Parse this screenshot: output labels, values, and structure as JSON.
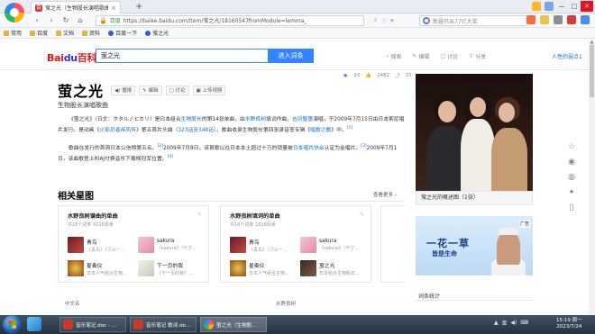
{
  "browser": {
    "tab_title": "萤之光（生物股长演唱歌曲）_百...",
    "tab_favicon": "百",
    "new_tab": "+",
    "safe_label": "百度",
    "url": "https://baike.baidu.com/item/萤之光/18160547fromModule=lemma_",
    "url_host": "https://baike.baidu.com",
    "side_search_placeholder": "新疆开出77亿大奖",
    "window_controls": [
      "—",
      "□",
      "✕"
    ]
  },
  "bookmarks": [
    "常用",
    "百度",
    "文档",
    "资料",
    "百度一下",
    "萤之光"
  ],
  "header": {
    "logo_bai": "Bai",
    "logo_du": "du",
    "logo_baike": "百科",
    "search_value": "萤之光",
    "search_button": "进入词条",
    "links": [
      "搜索",
      "编辑",
      "讨论",
      "分享"
    ],
    "user_link": "人性的弱点1"
  },
  "lemma": {
    "title": "萤之光",
    "actions": [
      "播报",
      "编辑",
      "讨论",
      "上传视频"
    ],
    "subtitle": "生物股长演唱歌曲",
    "stats": {
      "likes": "93",
      "views": "2482",
      "shares": "15"
    },
    "summary_p1_a": "《萤之光》（日文：ホタルノヒカリ）是日本组合",
    "summary_p1_link1": "生物股长",
    "summary_p1_b": "的第14张单曲，由",
    "summary_p1_link2": "水野良树",
    "summary_p1_c": "填词作曲，",
    "summary_p1_link3": "吉冈聖惠",
    "summary_p1_d": "演唱，于2009年7月15日由日本索尼唱片发行。是动画《",
    "summary_p1_link4": "火影忍者疾风传",
    "summary_p1_e": "》第五首片头曲（",
    "summary_p1_link5": "323话至348话",
    "summary_p1_f": "），歌曲收录生物股长第四张录音室专辑《",
    "summary_p1_link6": "唱歌之歌",
    "summary_p1_g": "》中。",
    "sup1": "[1]",
    "summary_p2_a": "歌曲在发行的首周日本公信榜第五名。",
    "sup2": "[2]",
    "summary_p2_b": "2009年7月8日，该首歌以在日本本土超过十万的销量被",
    "summary_p2_link": "日本唱片协会",
    "summary_p2_c": "认定为金唱片。",
    "sup3": "[3]",
    "summary_p2_d": "2009年7月1日，该曲歌登上RIAJ付费音乐下载榜冠军位置。",
    "sup4": "[4]"
  },
  "related": {
    "heading": "相关星图",
    "more": "查看更多 ›",
    "cards": [
      {
        "title": "水野良树谱曲的单曲",
        "sub": "共18个词条  4218阅读",
        "items": [
          {
            "name": "青鸟",
            "desc": "《青鸟》（ブルー..."
          },
          {
            "name": "sakura",
            "desc": "《sakura》（サク..."
          },
          {
            "name": "星奏仪",
            "desc": "日本人气组合生物..."
          },
          {
            "name": "下一页的我",
            "desc": "《下一页的我》..."
          }
        ]
      },
      {
        "title": "水野良树填词的单曲",
        "sub": "共18个词条  1828阅读",
        "items": [
          {
            "name": "青鸟",
            "desc": "《青鸟》（ブルー..."
          },
          {
            "name": "sakura",
            "desc": "《sakura》（サク..."
          },
          {
            "name": "星奏仪",
            "desc": "日本人气组合生物..."
          },
          {
            "name": "萤之光",
            "desc": "日本组合生物股长..."
          }
        ]
      }
    ]
  },
  "bottom_labels": [
    "中文名",
    "水野良树"
  ],
  "sidebar": {
    "image_caption": "萤之光的概述图（1张）",
    "ad_line1": "一花一草",
    "ad_line2": "皆是生命",
    "ad_tag": "广告",
    "stats_label": "词条统计"
  },
  "taskbar": {
    "tasks": [
      "音乐笔记.doc - ...",
      "音乐笔记 歌词.do...",
      "萤之光（生物股..."
    ],
    "time": "15:19 周一",
    "date": "2023/7/24"
  },
  "colors": {
    "accent": "#3385ff",
    "link": "#136ec2",
    "logo_red": "#de1a1a",
    "logo_blue": "#2932e1"
  }
}
